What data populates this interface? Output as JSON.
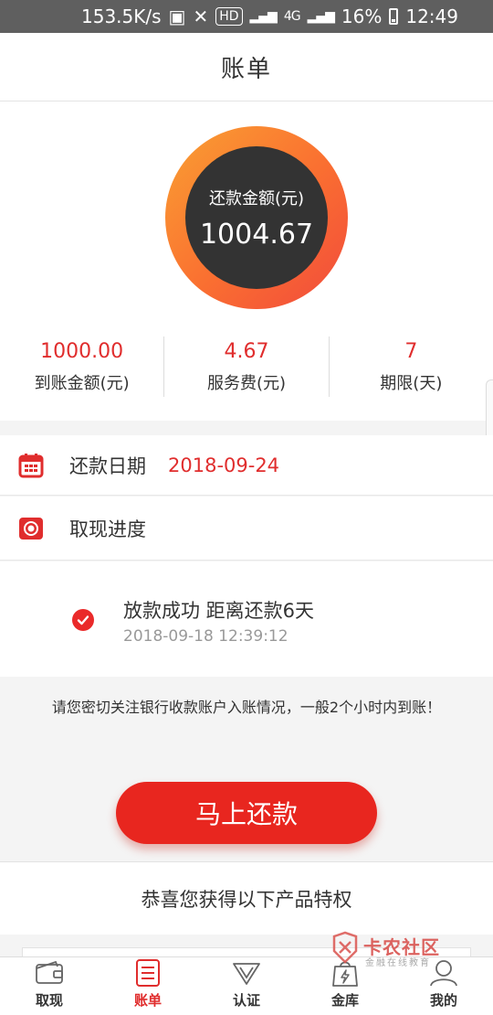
{
  "status_bar": {
    "speed": "153.5K/s",
    "hd": "HD",
    "net": "4G",
    "battery": "16%",
    "time": "12:49"
  },
  "header": {
    "title": "账单"
  },
  "summary": {
    "repay_label": "还款金额(元)",
    "repay_amount": "1004.67",
    "stats": [
      {
        "value": "1000.00",
        "label": "到账金额(元)"
      },
      {
        "value": "4.67",
        "label": "服务费(元)"
      },
      {
        "value": "7",
        "label": "期限(天)"
      }
    ]
  },
  "repay_date": {
    "label": "还款日期",
    "value": "2018-09-24",
    "icon": "calendar-icon"
  },
  "progress": {
    "label": "取现进度",
    "icon": "progress-icon",
    "status": "放款成功 距离还款6天",
    "time": "2018-09-18 12:39:12"
  },
  "notice": "请您密切关注银行收款账户入账情况，一般2个小时内到账！",
  "pay_button": "马上还款",
  "privilege_title": "恭喜您获得以下产品特权",
  "watermark": {
    "name": "卡农社区",
    "sub": "金融在线教育"
  },
  "tabs": [
    {
      "label": "取现",
      "icon": "wallet-icon",
      "active": false
    },
    {
      "label": "账单",
      "icon": "bill-icon",
      "active": true
    },
    {
      "label": "认证",
      "icon": "verify-icon",
      "active": false
    },
    {
      "label": "金库",
      "icon": "vault-icon",
      "active": false
    },
    {
      "label": "我的",
      "icon": "user-icon",
      "active": false
    }
  ],
  "colors": {
    "accent": "#e02d2d",
    "button": "#e8261f",
    "ring_start": "#f9a032",
    "ring_end": "#f14a3c",
    "ring_inner": "#333333"
  }
}
